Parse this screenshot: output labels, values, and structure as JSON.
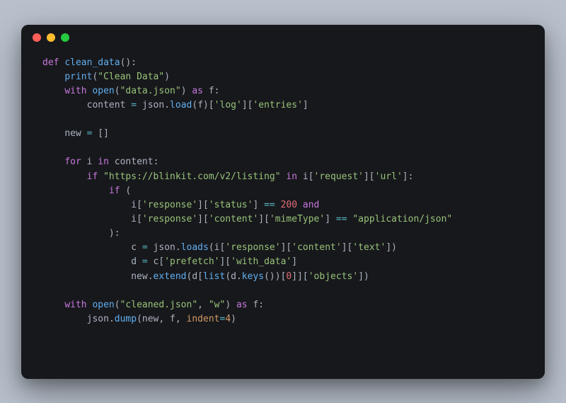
{
  "code": {
    "line1": {
      "def": "def",
      "name": "clean_data",
      "parens": "():"
    },
    "line2": {
      "fn": "print",
      "open": "(",
      "str": "\"Clean Data\"",
      "close": ")"
    },
    "line3": {
      "with": "with",
      "open_fn": "open",
      "p1": "(",
      "str": "\"data.json\"",
      "p2": ")",
      "as": "as",
      "var": "f",
      "colon": ":"
    },
    "line4": {
      "var": "content",
      "eq": " = ",
      "mod": "json",
      "dot": ".",
      "fn": "load",
      "p1": "(",
      "arg": "f",
      "p2": ")[",
      "k1": "'log'",
      "b1": "][",
      "k2": "'entries'",
      "b2": "]"
    },
    "line5": {
      "var": "new",
      "eq": " = ",
      "val": "[]"
    },
    "line6": {
      "for": "for",
      "i": "i",
      "in": "in",
      "var": "content",
      "colon": ":"
    },
    "line7": {
      "if": "if",
      "str": "\"https://blinkit.com/v2/listing\"",
      "in": "in",
      "var": "i",
      "b1": "[",
      "k1": "'request'",
      "b2": "][",
      "k2": "'url'",
      "b3": "]:"
    },
    "line8": {
      "if": "if",
      "p": " ("
    },
    "line9": {
      "var": "i",
      "b1": "[",
      "k1": "'response'",
      "b2": "][",
      "k2": "'status'",
      "b3": "] ",
      "eq": "==",
      "sp": " ",
      "num": "200",
      "and": " and"
    },
    "line10": {
      "var": "i",
      "b1": "[",
      "k1": "'response'",
      "b2": "][",
      "k2": "'content'",
      "b3": "][",
      "k3": "'mimeType'",
      "b4": "] ",
      "eq": "==",
      "sp": " ",
      "str": "\"application/json\""
    },
    "line11": {
      "p": "):"
    },
    "line12": {
      "var": "c",
      "eq": " = ",
      "mod": "json",
      "dot": ".",
      "fn": "loads",
      "p1": "(",
      "arg": "i",
      "b1": "[",
      "k1": "'response'",
      "b2": "][",
      "k2": "'content'",
      "b3": "][",
      "k3": "'text'",
      "b4": "])"
    },
    "line13": {
      "var": "d",
      "eq": " = ",
      "src": "c",
      "b1": "[",
      "k1": "'prefetch'",
      "b2": "][",
      "k2": "'with_data'",
      "b3": "]"
    },
    "line14": {
      "var": "new",
      "dot": ".",
      "fn": "extend",
      "p1": "(",
      "arg": "d",
      "b1": "[",
      "list": "list",
      "p2": "(",
      "arg2": "d",
      "dot2": ".",
      "fn2": "keys",
      "p3": "())[",
      "num": "0",
      "b2": "]][",
      "k1": "'objects'",
      "b3": "])"
    },
    "line15": {
      "with": "with",
      "open_fn": "open",
      "p1": "(",
      "s1": "\"cleaned.json\"",
      "c": ", ",
      "s2": "\"w\"",
      "p2": ")",
      "as": "as",
      "var": "f",
      "colon": ":"
    },
    "line16": {
      "mod": "json",
      "dot": ".",
      "fn": "dump",
      "p1": "(",
      "a1": "new",
      "c1": ", ",
      "a2": "f",
      "c2": ", ",
      "kw": "indent",
      "eq": "=",
      "num": "4",
      "p2": ")"
    }
  }
}
